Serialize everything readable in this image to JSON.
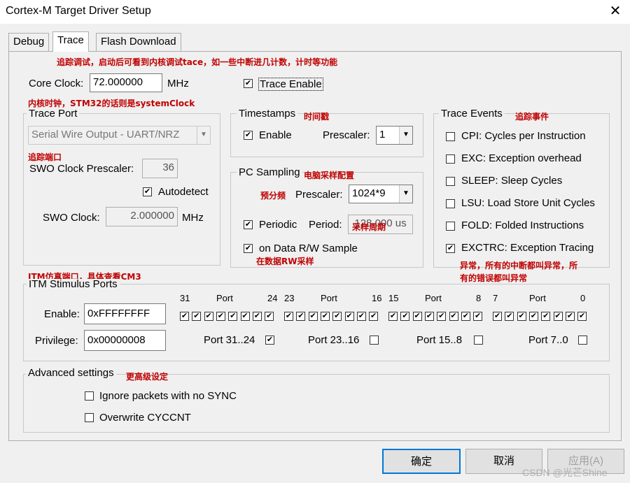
{
  "window": {
    "title": "Cortex-M Target Driver Setup"
  },
  "tabs": [
    "Debug",
    "Trace",
    "Flash Download"
  ],
  "annotations": {
    "top": "追踪调试，启动后可看到内核调试tace，如一些中断进几计数，计时等功能",
    "core_clock": "内核时钟，STM32的话则是systemClock",
    "trace_port": "追踪端口",
    "timestamps": "时间戳",
    "trace_events": "追踪事件",
    "pc_sampling": "电脑采样配置",
    "prescaler": "预分频",
    "period": "采样周期",
    "data_rw": "在数据RW采样",
    "exctrc_1": "异常，所有的中断都叫异常，所",
    "exctrc_2": "有的错误都叫异常",
    "itm": "ITM仿真端口，具体查看CM3",
    "advanced": "更高级设定"
  },
  "core_clock": {
    "label": "Core Clock:",
    "value": "72.000000",
    "unit": "MHz"
  },
  "trace_enable": {
    "label": "Trace Enable",
    "checked": true
  },
  "trace_port": {
    "title": "Trace Port",
    "selected": "Serial Wire Output - UART/NRZ",
    "swo_prescaler_label": "SWO Clock Prescaler:",
    "swo_prescaler_value": "36",
    "autodetect_label": "Autodetect",
    "swo_clock_label": "SWO Clock:",
    "swo_clock_value": "2.000000",
    "swo_clock_unit": "MHz"
  },
  "timestamps": {
    "title": "Timestamps",
    "enable_label": "Enable",
    "prescaler_label": "Prescaler:",
    "prescaler_value": "1"
  },
  "pc_sampling": {
    "title": "PC Sampling",
    "prescaler_label": "Prescaler:",
    "prescaler_value": "1024*9",
    "periodic_label": "Periodic",
    "period_label": "Period:",
    "period_value": "128.000 us",
    "data_rw_label": "on Data R/W Sample"
  },
  "trace_events": {
    "title": "Trace Events",
    "items": [
      {
        "label": "CPI: Cycles per Instruction",
        "checked": false
      },
      {
        "label": "EXC: Exception overhead",
        "checked": false
      },
      {
        "label": "SLEEP: Sleep Cycles",
        "checked": false
      },
      {
        "label": "LSU: Load Store Unit Cycles",
        "checked": false
      },
      {
        "label": "FOLD: Folded Instructions",
        "checked": false
      },
      {
        "label": "EXCTRC: Exception Tracing",
        "checked": true
      }
    ]
  },
  "itm": {
    "title": "ITM Stimulus Ports",
    "enable_label": "Enable:",
    "enable_value": "0xFFFFFFFF",
    "privilege_label": "Privilege:",
    "privilege_value": "0x00000008",
    "groups": [
      {
        "hi": "31",
        "port": "Port",
        "lo": "24",
        "priv_label": "Port 31..24",
        "priv_checked": true
      },
      {
        "hi": "23",
        "port": "Port",
        "lo": "16",
        "priv_label": "Port 23..16",
        "priv_checked": false
      },
      {
        "hi": "15",
        "port": "Port",
        "lo": "8",
        "priv_label": "Port 15..8",
        "priv_checked": false
      },
      {
        "hi": "7",
        "port": "Port",
        "lo": "0",
        "priv_label": "Port 7..0",
        "priv_checked": false
      }
    ]
  },
  "advanced": {
    "title": "Advanced settings",
    "ignore_label": "Ignore packets with no SYNC",
    "overwrite_label": "Overwrite CYCCNT"
  },
  "buttons": {
    "ok": "确定",
    "cancel": "取消",
    "apply": "应用(A)"
  },
  "watermark": "CSDN @光芒Shine",
  "check_glyph": "✔"
}
